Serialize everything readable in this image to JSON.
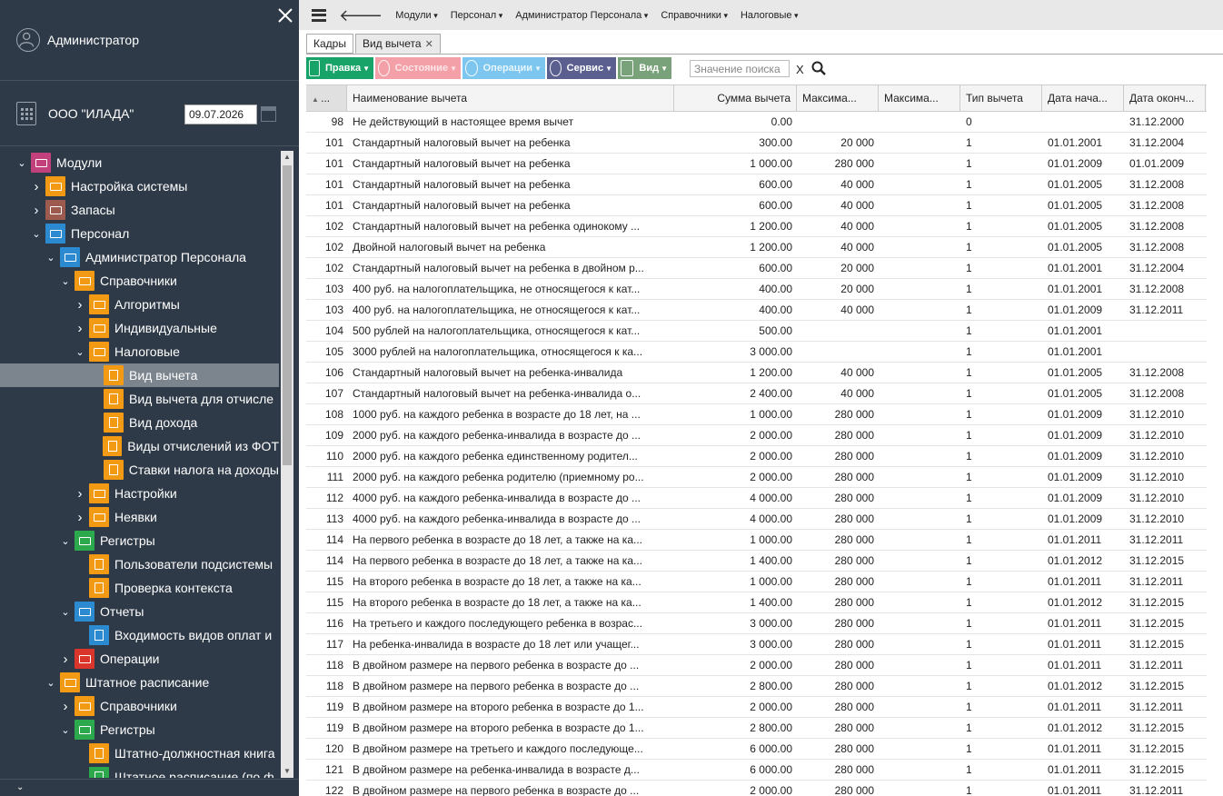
{
  "sidebar": {
    "user_name": "Администратор",
    "org_name": "ООО \"ИЛАДА\"",
    "date": "09.07.2026",
    "tree": [
      {
        "label": "Модули",
        "level": 0,
        "expanded": true,
        "icon": "modules-icon",
        "color": "pink"
      },
      {
        "label": "Настройка системы",
        "level": 1,
        "expanded": false,
        "icon": "settings-module-icon",
        "color": "orange"
      },
      {
        "label": "Запасы",
        "level": 1,
        "expanded": false,
        "icon": "stock-module-icon",
        "color": "brown"
      },
      {
        "label": "Персонал",
        "level": 1,
        "expanded": true,
        "icon": "personnel-module-icon",
        "color": "blue"
      },
      {
        "label": "Администратор Персонала",
        "level": 2,
        "expanded": true,
        "icon": "personnel-admin-icon",
        "color": "blue"
      },
      {
        "label": "Справочники",
        "level": 3,
        "expanded": true,
        "icon": "folder-icon",
        "color": "orange"
      },
      {
        "label": "Алгоритмы",
        "level": 4,
        "expanded": false,
        "icon": "folder-icon",
        "color": "orange"
      },
      {
        "label": "Индивидуальные",
        "level": 4,
        "expanded": false,
        "icon": "folder-icon",
        "color": "orange"
      },
      {
        "label": "Налоговые",
        "level": 4,
        "expanded": true,
        "icon": "folder-icon",
        "color": "orange"
      },
      {
        "label": "Вид вычета",
        "level": 5,
        "leaf": true,
        "selected": true,
        "icon": "document-icon",
        "color": "orange"
      },
      {
        "label": "Вид вычета для отчисле",
        "level": 5,
        "leaf": true,
        "icon": "document-icon",
        "color": "orange"
      },
      {
        "label": "Вид дохода",
        "level": 5,
        "leaf": true,
        "icon": "document-icon",
        "color": "orange"
      },
      {
        "label": "Виды отчислений из ФОТ",
        "level": 5,
        "leaf": true,
        "icon": "document-icon",
        "color": "orange"
      },
      {
        "label": "Ставки налога на доходы",
        "level": 5,
        "leaf": true,
        "icon": "document-icon",
        "color": "orange"
      },
      {
        "label": "Настройки",
        "level": 4,
        "expanded": false,
        "icon": "folder-icon",
        "color": "orange"
      },
      {
        "label": "Неявки",
        "level": 4,
        "expanded": false,
        "icon": "folder-icon",
        "color": "orange"
      },
      {
        "label": "Регистры",
        "level": 3,
        "expanded": true,
        "icon": "folder-icon",
        "color": "green"
      },
      {
        "label": "Пользователи подсистемы",
        "level": 4,
        "leaf": true,
        "icon": "document-icon",
        "color": "orange"
      },
      {
        "label": "Проверка контекста",
        "level": 4,
        "leaf": true,
        "icon": "document-icon",
        "color": "orange"
      },
      {
        "label": "Отчеты",
        "level": 3,
        "expanded": true,
        "icon": "folder-icon",
        "color": "blue"
      },
      {
        "label": "Входимость видов оплат и",
        "level": 4,
        "leaf": true,
        "icon": "document-icon",
        "color": "blue"
      },
      {
        "label": "Операции",
        "level": 3,
        "expanded": false,
        "icon": "folder-icon",
        "color": "red"
      },
      {
        "label": "Штатное расписание",
        "level": 2,
        "expanded": true,
        "icon": "staffing-icon",
        "color": "orange"
      },
      {
        "label": "Справочники",
        "level": 3,
        "expanded": false,
        "icon": "folder-icon",
        "color": "orange"
      },
      {
        "label": "Регистры",
        "level": 3,
        "expanded": true,
        "icon": "folder-icon",
        "color": "green"
      },
      {
        "label": "Штатно-должностная книга",
        "level": 4,
        "leaf": true,
        "icon": "document-icon",
        "color": "orange"
      },
      {
        "label": "Штатное расписание (по ф",
        "level": 4,
        "leaf": true,
        "icon": "document-icon",
        "color": "green"
      }
    ]
  },
  "topbar": {
    "menus": [
      "Модули",
      "Персонал",
      "Администратор Персонала",
      "Справочники",
      "Налоговые"
    ]
  },
  "tabs": [
    {
      "label": "Кадры",
      "active": false
    },
    {
      "label": "Вид вычета",
      "active": true,
      "closable": true
    }
  ],
  "toolbar": {
    "buttons": [
      {
        "label": "Правка",
        "color": "#18a368",
        "icon": "edit-icon"
      },
      {
        "label": "Состояние",
        "color": "#f3a0a8",
        "icon": "state-icon"
      },
      {
        "label": "Операции",
        "color": "#7cc6ef",
        "icon": "operations-icon"
      },
      {
        "label": "Сервис",
        "color": "#5a5f8f",
        "icon": "service-icon"
      },
      {
        "label": "Вид",
        "color": "#7aa27a",
        "icon": "view-icon"
      }
    ],
    "search_placeholder": "Значение поиска",
    "search_clear": "X"
  },
  "grid": {
    "columns": [
      "...",
      "Наименование вычета",
      "Сумма вычета",
      "Максима...",
      "Максима...",
      "Тип вычета",
      "Дата нача...",
      "Дата оконч..."
    ],
    "rows": [
      [
        "98",
        "Не действующий в настоящее время вычет",
        "0.00",
        "",
        "",
        "0",
        "",
        "31.12.2000"
      ],
      [
        "101",
        "Стандартный налоговый вычет на ребенка",
        "300.00",
        "20 000",
        "",
        "1",
        "01.01.2001",
        "31.12.2004"
      ],
      [
        "101",
        "Стандартный налоговый вычет на ребенка",
        "1 000.00",
        "280 000",
        "",
        "1",
        "01.01.2009",
        "01.01.2009"
      ],
      [
        "101",
        "Стандартный налоговый вычет на ребенка",
        "600.00",
        "40 000",
        "",
        "1",
        "01.01.2005",
        "31.12.2008"
      ],
      [
        "101",
        "Стандартный налоговый вычет на ребенка",
        "600.00",
        "40 000",
        "",
        "1",
        "01.01.2005",
        "31.12.2008"
      ],
      [
        "102",
        "Стандартный налоговый вычет на ребенка одинокому ...",
        "1 200.00",
        "40 000",
        "",
        "1",
        "01.01.2005",
        "31.12.2008"
      ],
      [
        "102",
        "Двойной налоговый вычет на ребенка",
        "1 200.00",
        "40 000",
        "",
        "1",
        "01.01.2005",
        "31.12.2008"
      ],
      [
        "102",
        "Стандартный налоговый вычет на ребенка в двойном р...",
        "600.00",
        "20 000",
        "",
        "1",
        "01.01.2001",
        "31.12.2004"
      ],
      [
        "103",
        "400 руб. на налогоплательщика, не относящегося к кат...",
        "400.00",
        "20 000",
        "",
        "1",
        "01.01.2001",
        "31.12.2008"
      ],
      [
        "103",
        "400 руб. на налогоплательщика, не относящегося к кат...",
        "400.00",
        "40 000",
        "",
        "1",
        "01.01.2009",
        "31.12.2011"
      ],
      [
        "104",
        "500 рублей на налогоплательщика, относящегося к кат...",
        "500.00",
        "",
        "",
        "1",
        "01.01.2001",
        ""
      ],
      [
        "105",
        "3000 рублей на налогоплательщика, относящегося к ка...",
        "3 000.00",
        "",
        "",
        "1",
        "01.01.2001",
        ""
      ],
      [
        "106",
        "Стандартный налоговый вычет на ребенка-инвалида",
        "1 200.00",
        "40 000",
        "",
        "1",
        "01.01.2005",
        "31.12.2008"
      ],
      [
        "107",
        "Стандартный налоговый вычет на ребенка-инвалида о...",
        "2 400.00",
        "40 000",
        "",
        "1",
        "01.01.2005",
        "31.12.2008"
      ],
      [
        "108",
        "1000 руб. на каждого ребенка в возрасте до 18 лет, на ...",
        "1 000.00",
        "280 000",
        "",
        "1",
        "01.01.2009",
        "31.12.2010"
      ],
      [
        "109",
        "2000 руб. на каждого ребенка-инвалида в возрасте до ...",
        "2 000.00",
        "280 000",
        "",
        "1",
        "01.01.2009",
        "31.12.2010"
      ],
      [
        "110",
        "2000 руб. на каждого ребенка единственному родител...",
        "2 000.00",
        "280 000",
        "",
        "1",
        "01.01.2009",
        "31.12.2010"
      ],
      [
        "111",
        "2000 руб. на каждого ребенка родителю (приемному ро...",
        "2 000.00",
        "280 000",
        "",
        "1",
        "01.01.2009",
        "31.12.2010"
      ],
      [
        "112",
        "4000 руб. на каждого ребенка-инвалида в возрасте до ...",
        "4 000.00",
        "280 000",
        "",
        "1",
        "01.01.2009",
        "31.12.2010"
      ],
      [
        "113",
        "4000 руб. на каждого ребенка-инвалида в возрасте до ...",
        "4 000.00",
        "280 000",
        "",
        "1",
        "01.01.2009",
        "31.12.2010"
      ],
      [
        "114",
        "На первого ребенка в возрасте до 18 лет, а также на ка...",
        "1 000.00",
        "280 000",
        "",
        "1",
        "01.01.2011",
        "31.12.2011"
      ],
      [
        "114",
        "На первого ребенка в возрасте до 18 лет, а также на ка...",
        "1 400.00",
        "280 000",
        "",
        "1",
        "01.01.2012",
        "31.12.2015"
      ],
      [
        "115",
        "На второго ребенка в возрасте до 18 лет, а также на ка...",
        "1 000.00",
        "280 000",
        "",
        "1",
        "01.01.2011",
        "31.12.2011"
      ],
      [
        "115",
        "На второго ребенка в возрасте до 18 лет, а также на ка...",
        "1 400.00",
        "280 000",
        "",
        "1",
        "01.01.2012",
        "31.12.2015"
      ],
      [
        "116",
        "На третьего и каждого последующего ребенка в возрас...",
        "3 000.00",
        "280 000",
        "",
        "1",
        "01.01.2011",
        "31.12.2015"
      ],
      [
        "117",
        "На ребенка-инвалида в возрасте до 18 лет или учащег...",
        "3 000.00",
        "280 000",
        "",
        "1",
        "01.01.2011",
        "31.12.2015"
      ],
      [
        "118",
        "В двойном размере на первого ребенка в возрасте до ...",
        "2 000.00",
        "280 000",
        "",
        "1",
        "01.01.2011",
        "31.12.2011"
      ],
      [
        "118",
        "В двойном размере на первого ребенка в возрасте до ...",
        "2 800.00",
        "280 000",
        "",
        "1",
        "01.01.2012",
        "31.12.2015"
      ],
      [
        "119",
        "В двойном размере на второго ребенка в возрасте до 1...",
        "2 000.00",
        "280 000",
        "",
        "1",
        "01.01.2011",
        "31.12.2011"
      ],
      [
        "119",
        "В двойном размере на второго ребенка в возрасте до 1...",
        "2 800.00",
        "280 000",
        "",
        "1",
        "01.01.2012",
        "31.12.2015"
      ],
      [
        "120",
        "В двойном размере на третьего и каждого последующе...",
        "6 000.00",
        "280 000",
        "",
        "1",
        "01.01.2011",
        "31.12.2015"
      ],
      [
        "121",
        "В двойном размере на ребенка-инвалида в возрасте д...",
        "6 000.00",
        "280 000",
        "",
        "1",
        "01.01.2011",
        "31.12.2015"
      ],
      [
        "122",
        "В двойном размере на первого ребенка в возрасте до ...",
        "2 000.00",
        "280 000",
        "",
        "1",
        "01.01.2011",
        "31.12.2011"
      ]
    ]
  }
}
